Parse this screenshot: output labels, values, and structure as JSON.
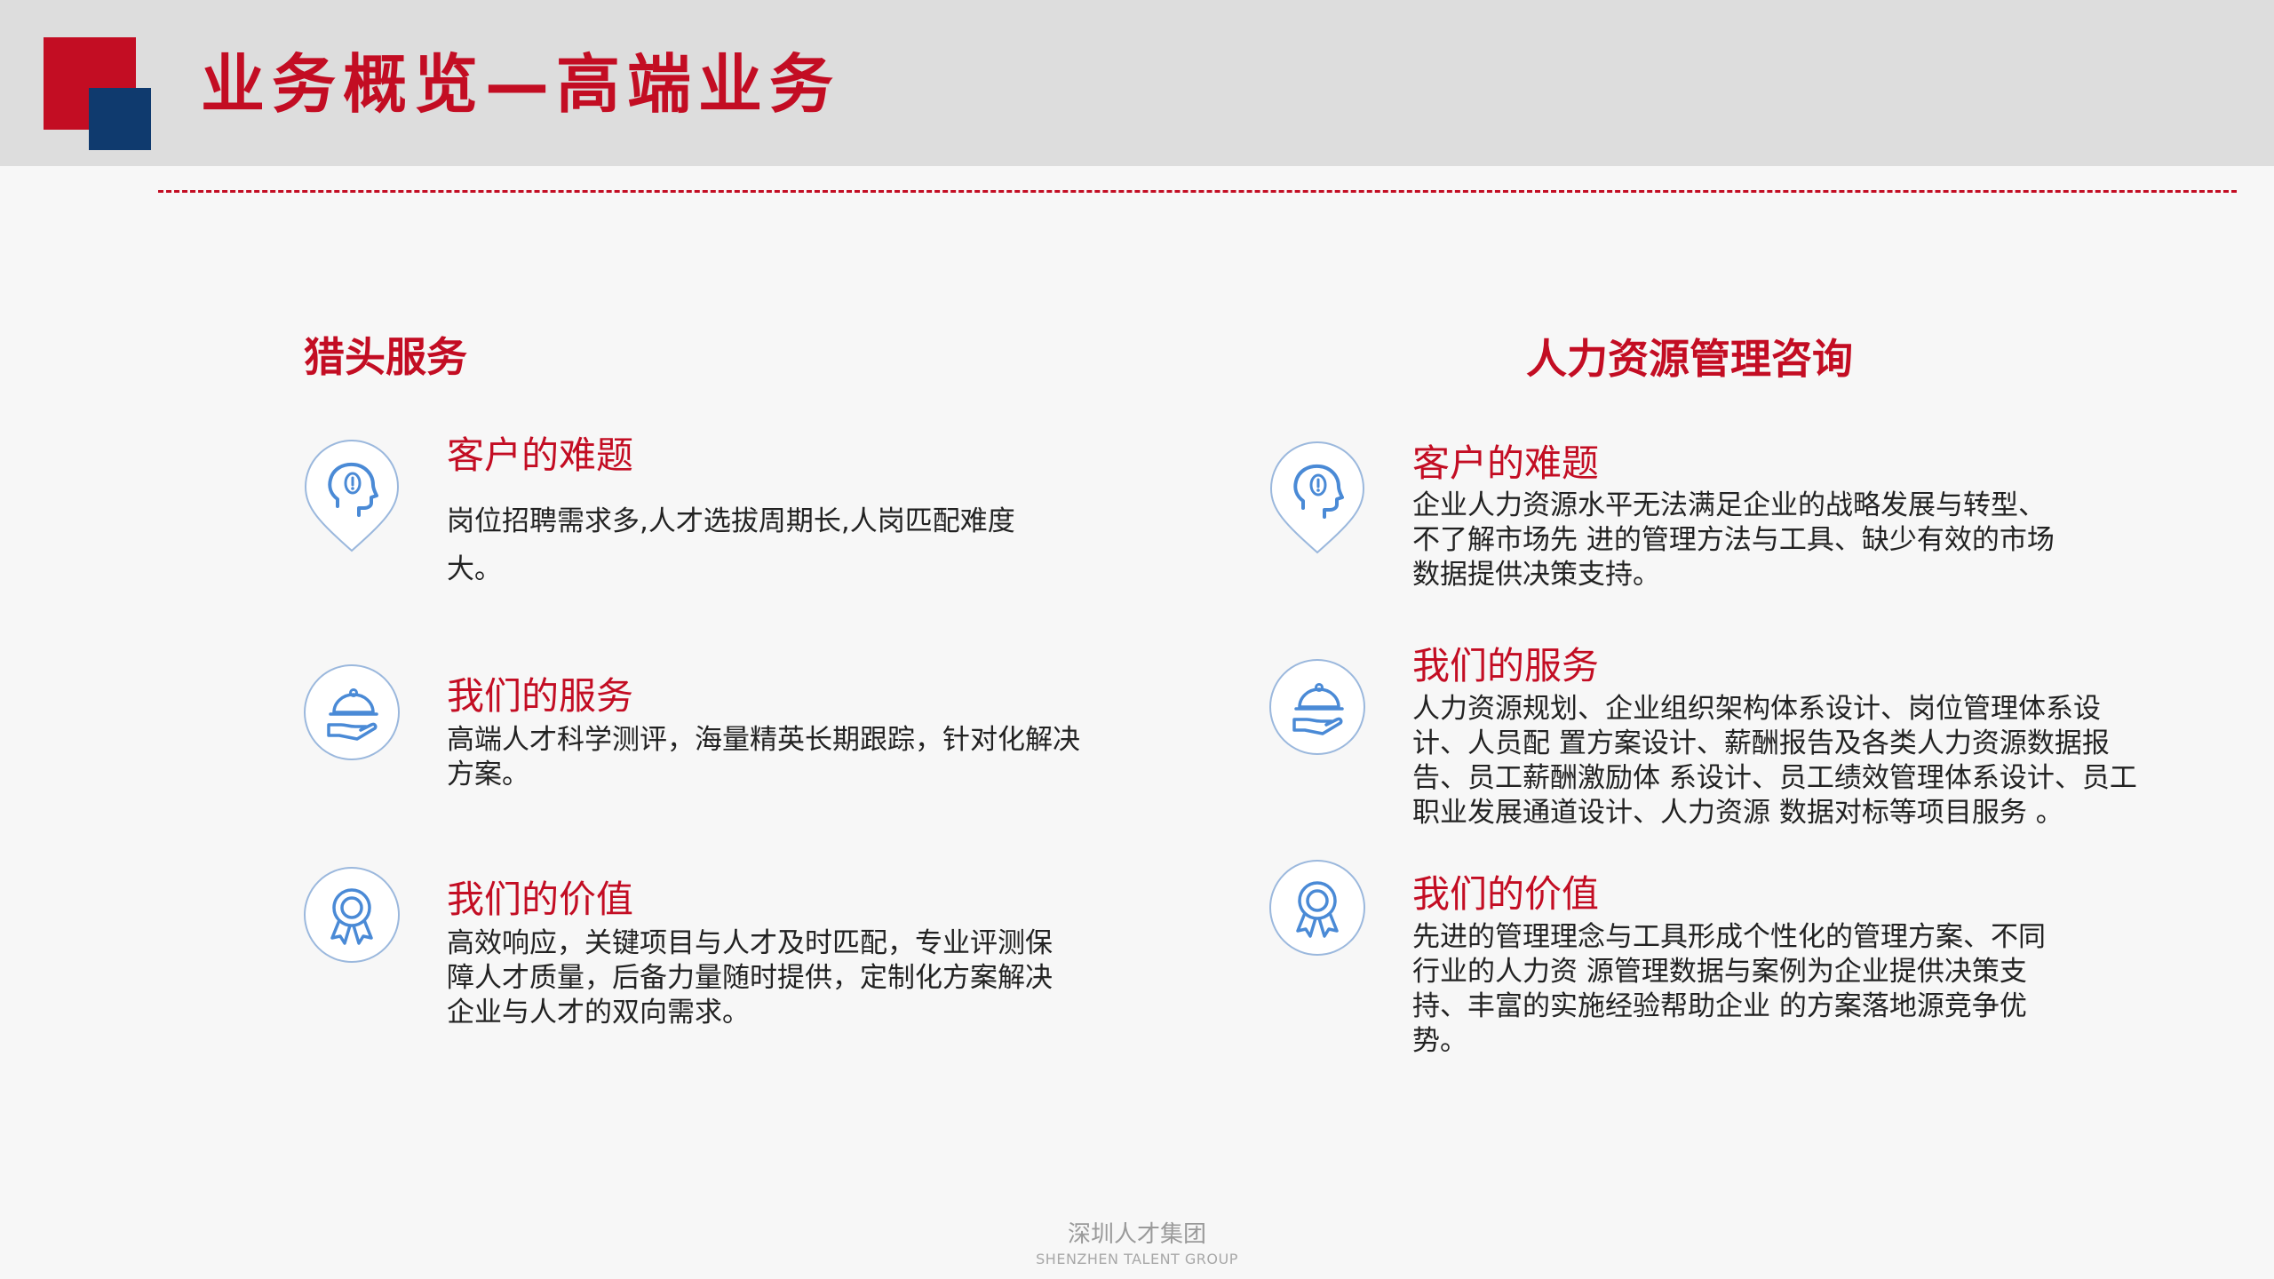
{
  "title": "业务概览—高端业务",
  "colors": {
    "brand_red": "#c30d23",
    "brand_blue": "#0f3a6e",
    "icon_blue": "#4a8ad6"
  },
  "left": {
    "title": "猎头服务",
    "blocks": [
      {
        "icon": "head-exclamation-icon",
        "heading": "客户的难题",
        "body": "岗位招聘需求多,人才选拔周期长,人岗匹配难度大。"
      },
      {
        "icon": "service-cloche-icon",
        "heading": "我们的服务",
        "body": "高端人才科学测评，海量精英长期跟踪，针对化解决方案。"
      },
      {
        "icon": "award-medal-icon",
        "heading": "我们的价值",
        "body": "高效响应，关键项目与人才及时匹配，专业评测保障人才质量，后备力量随时提供，定制化方案解决企业与人才的双向需求。"
      }
    ]
  },
  "right": {
    "title": "人力资源管理咨询",
    "blocks": [
      {
        "icon": "head-exclamation-icon",
        "heading": "客户的难题",
        "body": "企业人力资源水平无法满足企业的战略发展与转型、不了解市场先 进的管理方法与工具、缺少有效的市场数据提供决策支持。"
      },
      {
        "icon": "service-cloche-icon",
        "heading": "我们的服务",
        "body": "人力资源规划、企业组织架构体系设计、岗位管理体系设计、人员配 置方案设计、薪酬报告及各类人力资源数据报告、员工薪酬激励体 系设计、员工绩效管理体系设计、员工职业发展通道设计、人力资源 数据对标等项目服务 。"
      },
      {
        "icon": "award-medal-icon",
        "heading": "我们的价值",
        "body": "先进的管理理念与工具形成个性化的管理方案、不同行业的人力资 源管理数据与案例为企业提供决策支持、丰富的实施经验帮助企业 的方案落地源竞争优势。"
      }
    ]
  },
  "footer": {
    "cn": "深圳人才集团",
    "en": "SHENZHEN TALENT GROUP"
  }
}
